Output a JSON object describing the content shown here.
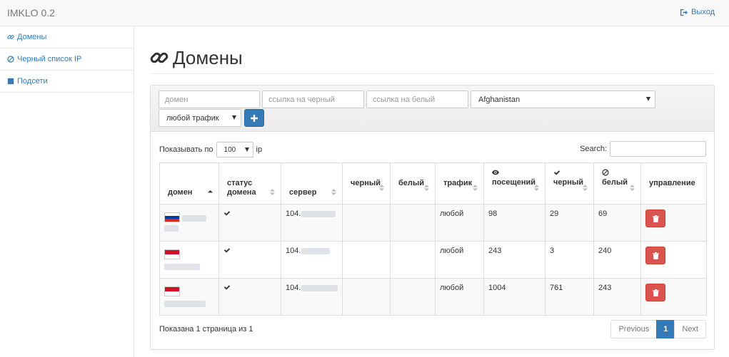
{
  "app": {
    "brand": "IMKLO 0.2",
    "logout_label": "Выход"
  },
  "sidebar": {
    "items": [
      {
        "label": "Домены",
        "icon": "link-icon"
      },
      {
        "label": "Черный список IP",
        "icon": "ban-icon"
      },
      {
        "label": "Подсети",
        "icon": "stop-square-icon"
      }
    ]
  },
  "page": {
    "title": "Домены"
  },
  "filters": {
    "domain_placeholder": "домен",
    "black_link_placeholder": "ссылка на черный",
    "white_link_placeholder": "ссылка на белый",
    "country_value": "Afghanistan",
    "traffic_value": "любой трафик",
    "add_icon": "plus-icon"
  },
  "table_controls": {
    "show_prefix": "Показывать по",
    "page_length": "100",
    "show_suffix": "ip",
    "search_label": "Search:"
  },
  "table": {
    "columns": [
      {
        "label": "домен",
        "icon": ""
      },
      {
        "label": "статус домена",
        "icon": ""
      },
      {
        "label": "сервер",
        "icon": ""
      },
      {
        "label": "черный",
        "icon": ""
      },
      {
        "label": "белый",
        "icon": ""
      },
      {
        "label": "трафик",
        "icon": ""
      },
      {
        "label": "посещений",
        "icon": "eye-icon"
      },
      {
        "label": "черный",
        "icon": "check-icon"
      },
      {
        "label": "белый",
        "icon": "ban-icon"
      },
      {
        "label": "управление",
        "icon": ""
      }
    ],
    "rows": [
      {
        "flag": "russia",
        "status": "check",
        "server": "104.",
        "traffic": "любой",
        "visits": "98",
        "black": "29",
        "white": "69"
      },
      {
        "flag": "indonesia",
        "status": "check",
        "server": "104.",
        "traffic": "любой",
        "visits": "243",
        "black": "3",
        "white": "240"
      },
      {
        "flag": "indonesia",
        "status": "check",
        "server": "104.",
        "traffic": "любой",
        "visits": "1004",
        "black": "761",
        "white": "243"
      }
    ]
  },
  "footer": {
    "info": "Показана 1 страница из 1",
    "previous_label": "Previous",
    "current_page": "1",
    "next_label": "Next"
  },
  "colors": {
    "primary": "#337ab7",
    "danger": "#d9534f",
    "border": "#dddddd"
  }
}
